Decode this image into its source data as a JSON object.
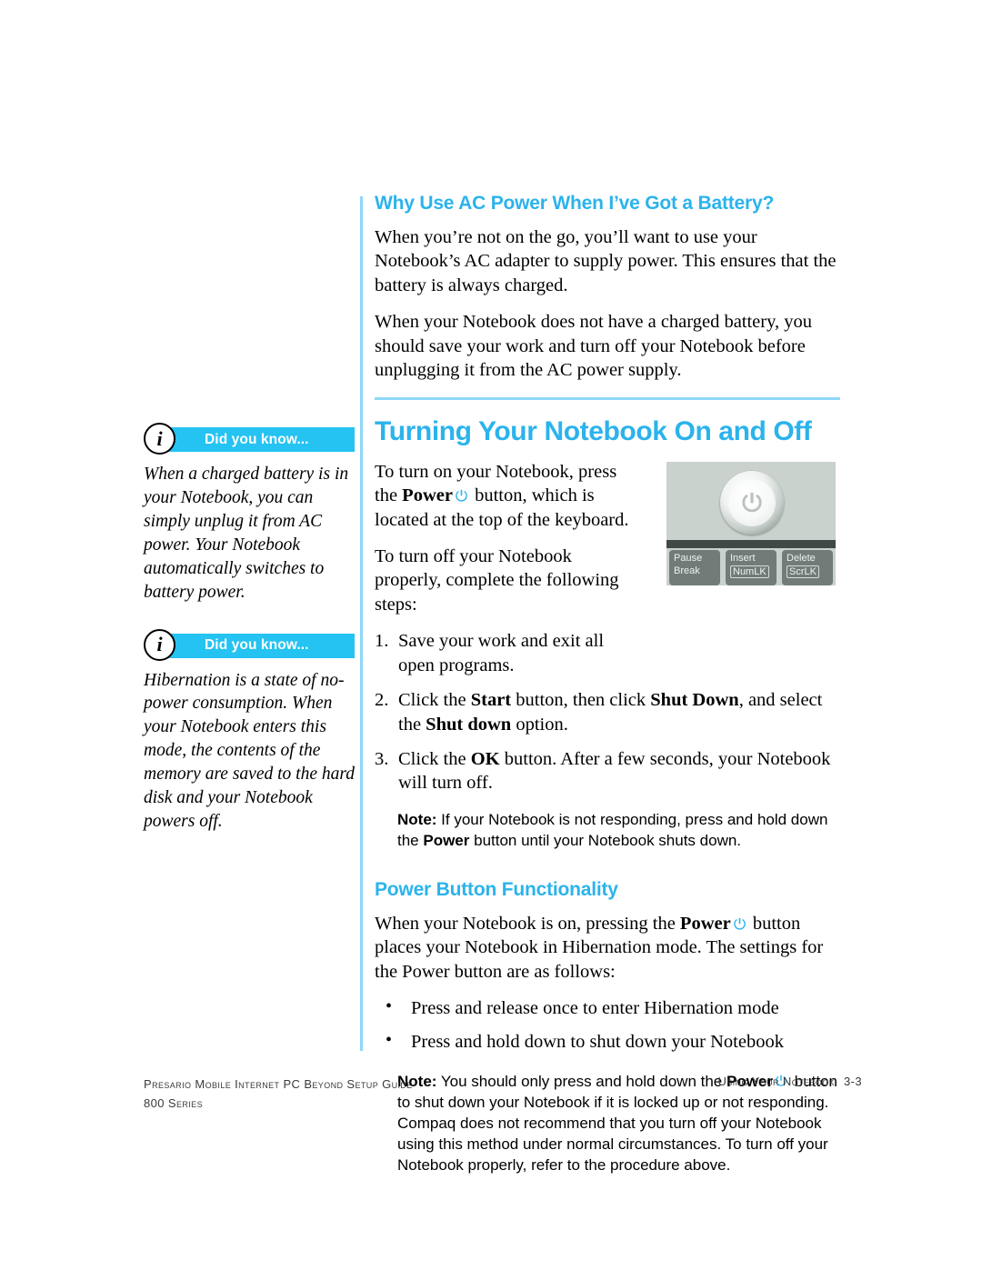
{
  "document": {
    "accent_color": "#2bb3ec",
    "rule_color": "#8ed8f8",
    "banner_color": "#25c3f2"
  },
  "sidebar": {
    "callouts": [
      {
        "icon": "info-icon",
        "banner_label": "Did you know...",
        "body": "When a charged battery is in your Notebook, you can simply unplug it from AC power. Your Notebook automatically switches to battery power."
      },
      {
        "icon": "info-icon",
        "banner_label": "Did you know...",
        "body": "Hibernation is a state of no-power consumption. When your Notebook enters this mode, the contents of the memory are saved to the hard disk and your Notebook powers off."
      }
    ]
  },
  "main": {
    "section_ac": {
      "heading": "Why Use AC Power When I’ve Got a Battery?",
      "paragraph_1": "When you’re not on the go, you’ll want to use your Notebook’s AC adapter to supply power. This ensures that the battery is always charged.",
      "paragraph_2": "When your Notebook does not have a charged battery, you should save your work and turn off your Notebook before unplugging it from the AC power supply."
    },
    "section_turning": {
      "heading": "Turning Your Notebook On and Off",
      "intro_1_before": "To turn on your Notebook, press the ",
      "intro_1_bold": "Power",
      "intro_1_after": " button, which is located at the top of the keyboard.",
      "intro_2": "To turn off your Notebook properly, complete the following steps:",
      "steps": [
        {
          "number": "1.",
          "text": "Save your work and exit all open programs."
        },
        {
          "number": "2.",
          "text_parts": [
            "Click the ",
            "Start",
            " button, then click ",
            "Shut Down",
            ", and select the ",
            "Shut down",
            " option."
          ]
        },
        {
          "number": "3.",
          "text_parts": [
            "Click the ",
            "OK",
            " button. After a few seconds, your Notebook will turn off."
          ]
        }
      ],
      "note": {
        "lead": "Note:",
        "text_before": " If your Notebook is not responding, press and hold down the ",
        "bold": "Power",
        "text_after": " button until your Notebook shuts down."
      }
    },
    "section_power_button": {
      "heading": "Power Button Functionality",
      "paragraph_before": "When your Notebook is on, pressing the ",
      "paragraph_bold": "Power",
      "paragraph_after": " button places your Notebook in Hibernation mode. The settings for the Power button are as follows:",
      "bullets": [
        "Press and release once to enter Hibernation mode",
        "Press and hold down to shut down your Notebook"
      ],
      "note": {
        "lead": "Note:",
        "text_before": " You should only press and hold down the ",
        "bold": "Power",
        "text_after": " button to shut down your Notebook if it is locked up or not responding. Compaq does not recommend that you turn off your Notebook using this method under normal circumstances. To turn off your Notebook properly, refer to the procedure above."
      }
    }
  },
  "photo": {
    "caption_keys": [
      {
        "top": "Pause",
        "bottom": "Break",
        "bottom_boxed": false
      },
      {
        "top": "Insert",
        "bottom": "NumLK",
        "bottom_boxed": true
      },
      {
        "top": "Delete",
        "bottom": "ScrLK",
        "bottom_boxed": true
      }
    ]
  },
  "footer": {
    "left_line_1": "Presario Mobile Internet PC Beyond Setup Guide",
    "left_line_2": "800 Series",
    "right_label": "Using Your Notebook",
    "page_number": "3-3"
  }
}
